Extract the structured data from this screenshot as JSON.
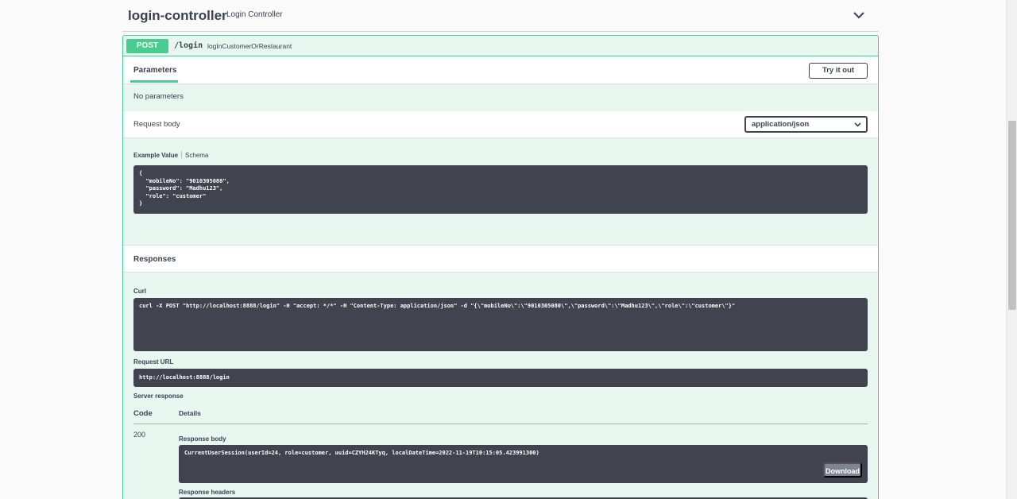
{
  "tag": {
    "title": "login-controller",
    "description": "Login Controller"
  },
  "operation": {
    "method": "POST",
    "path": "/login",
    "operation_id": "logInCustomerOrRestaurant",
    "method_color": "#49cc90"
  },
  "parameters": {
    "tab_label": "Parameters",
    "try_button": "Try it out",
    "empty_text": "No parameters"
  },
  "request_body": {
    "label": "Request body",
    "content_type": "application/json",
    "example_tab": "Example Value",
    "schema_tab": "Schema",
    "example_json": "{\n  \"mobileNo\": \"9010305080\",\n  \"password\": \"Madhu123\",\n  \"role\": \"customer\"\n}"
  },
  "responses": {
    "title": "Responses",
    "curl_label": "Curl",
    "curl_command": "curl -X POST \"http://localhost:8888/login\" -H \"accept: */*\" -H \"Content-Type: application/json\" -d \"{\\\"mobileNo\\\":\\\"9010305080\\\",\\\"password\\\":\\\"Madhu123\\\",\\\"role\\\":\\\"customer\\\"}\"",
    "request_url_label": "Request URL",
    "request_url": "http://localhost:8888/login",
    "server_response_label": "Server response",
    "code_header": "Code",
    "details_header": "Details",
    "status_code": "200",
    "response_body_label": "Response body",
    "response_body": "CurrentUserSession(userId=24, role=customer, uuid=CZYH24KTyq, localDateTime=2022-11-19T10:15:05.423991300)",
    "download_button": "Download",
    "response_headers_label": "Response headers"
  }
}
